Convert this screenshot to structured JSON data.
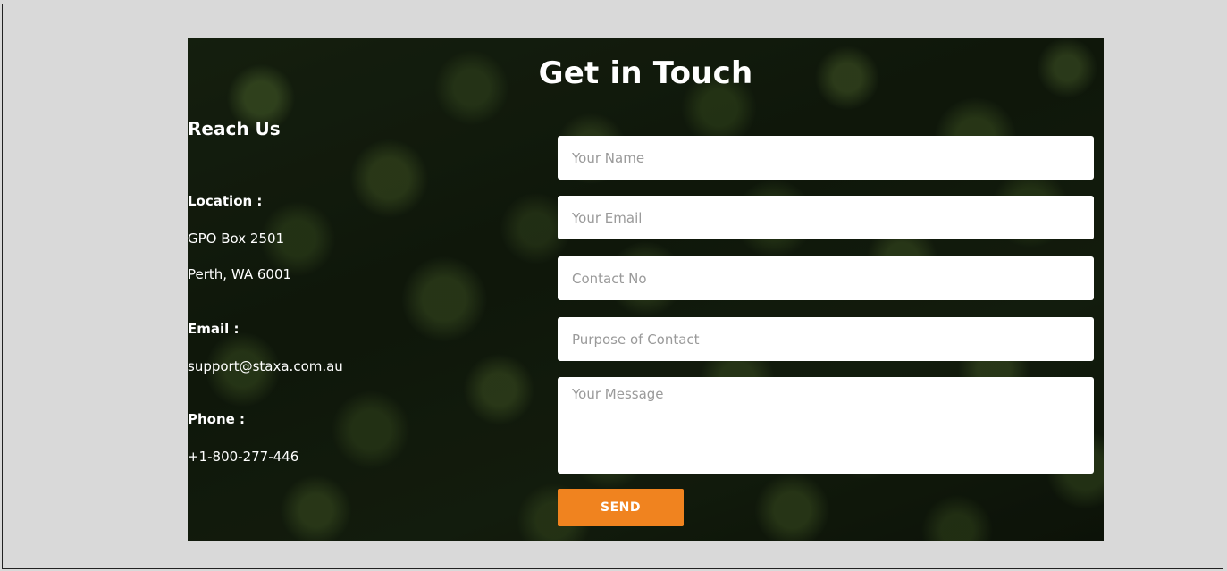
{
  "contact": {
    "title": "Get in Touch",
    "reach_heading": "Reach Us",
    "location_label": "Location :",
    "location_line1": "GPO Box 2501",
    "location_line2": "Perth, WA 6001",
    "email_label": "Email :",
    "email_value": "support@staxa.com.au",
    "phone_label": "Phone :",
    "phone_value": "+1-800-277-446"
  },
  "form": {
    "name_placeholder": "Your Name",
    "email_placeholder": "Your Email",
    "contact_no_placeholder": "Contact No",
    "purpose_placeholder": "Purpose of Contact",
    "message_placeholder": "Your Message",
    "send_label": "SEND"
  },
  "colors": {
    "page_background": "#d9d9d9",
    "send_button": "#f0831f",
    "text_light": "#ffffff"
  }
}
